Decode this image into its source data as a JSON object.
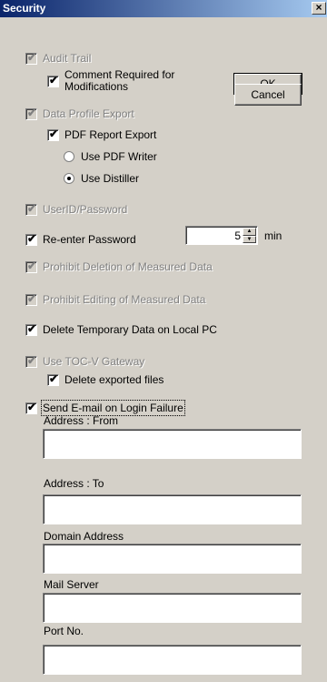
{
  "window": {
    "title": "Security",
    "close_glyph": "×"
  },
  "buttons": {
    "ok": "OK",
    "cancel": "Cancel"
  },
  "options": {
    "audit_trail": {
      "label": "Audit Trail",
      "checked": true,
      "enabled": false
    },
    "comment_required": {
      "label": "Comment Required for Modifications",
      "checked": true,
      "enabled": true
    },
    "data_profile_export": {
      "label": "Data Profile Export",
      "checked": true,
      "enabled": false
    },
    "pdf_report_export": {
      "label": "PDF Report Export",
      "checked": true,
      "enabled": true
    },
    "use_pdf_writer": {
      "label": "Use PDF Writer",
      "selected": false
    },
    "use_distiller": {
      "label": "Use Distiller",
      "selected": true
    },
    "userid_password": {
      "label": "UserID/Password",
      "checked": true,
      "enabled": false
    },
    "reenter_password": {
      "label": "Re-enter Password",
      "checked": true,
      "enabled": true,
      "minutes": "5",
      "unit": "min"
    },
    "prohibit_deletion": {
      "label": "Prohibit Deletion of Measured Data",
      "checked": true,
      "enabled": false
    },
    "prohibit_editing": {
      "label": "Prohibit Editing of Measured Data",
      "checked": true,
      "enabled": false
    },
    "delete_temp_data": {
      "label": "Delete Temporary Data on Local PC",
      "checked": true,
      "enabled": true
    },
    "use_tocv_gateway": {
      "label": "Use TOC-V Gateway",
      "checked": true,
      "enabled": false
    },
    "delete_exported_files": {
      "label": "Delete exported files",
      "checked": true,
      "enabled": true
    },
    "send_email_failure": {
      "label": "Send E-mail on Login Failure",
      "checked": true,
      "enabled": true
    }
  },
  "email": {
    "address_from": {
      "label": "Address : From",
      "value": ""
    },
    "address_to": {
      "label": "Address : To",
      "value": ""
    },
    "domain_address": {
      "label": "Domain Address",
      "value": ""
    },
    "mail_server": {
      "label": "Mail Server",
      "value": ""
    },
    "port_no": {
      "label": "Port No.",
      "value": ""
    }
  },
  "icons": {
    "check": "check-mark-icon",
    "close": "close-icon",
    "spin_up": "spin-up-icon",
    "spin_down": "spin-down-icon"
  },
  "colors": {
    "titlebar_start": "#0a246a",
    "titlebar_end": "#a6caf0",
    "face": "#d4d0c8",
    "disabled_text": "#808080"
  }
}
